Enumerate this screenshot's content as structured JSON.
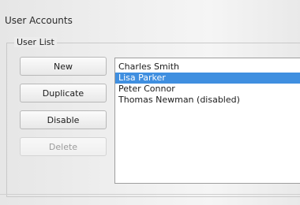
{
  "window": {
    "title": "User Accounts"
  },
  "group": {
    "label": "User List"
  },
  "buttons": {
    "new": "New",
    "duplicate": "Duplicate",
    "disable": "Disable",
    "delete": "Delete"
  },
  "users": [
    {
      "name": "Charles Smith",
      "selected": false
    },
    {
      "name": "Lisa Parker",
      "selected": true
    },
    {
      "name": "Peter Connor",
      "selected": false
    },
    {
      "name": "Thomas Newman (disabled)",
      "selected": false
    }
  ],
  "colors": {
    "selection": "#3f8fe0"
  }
}
